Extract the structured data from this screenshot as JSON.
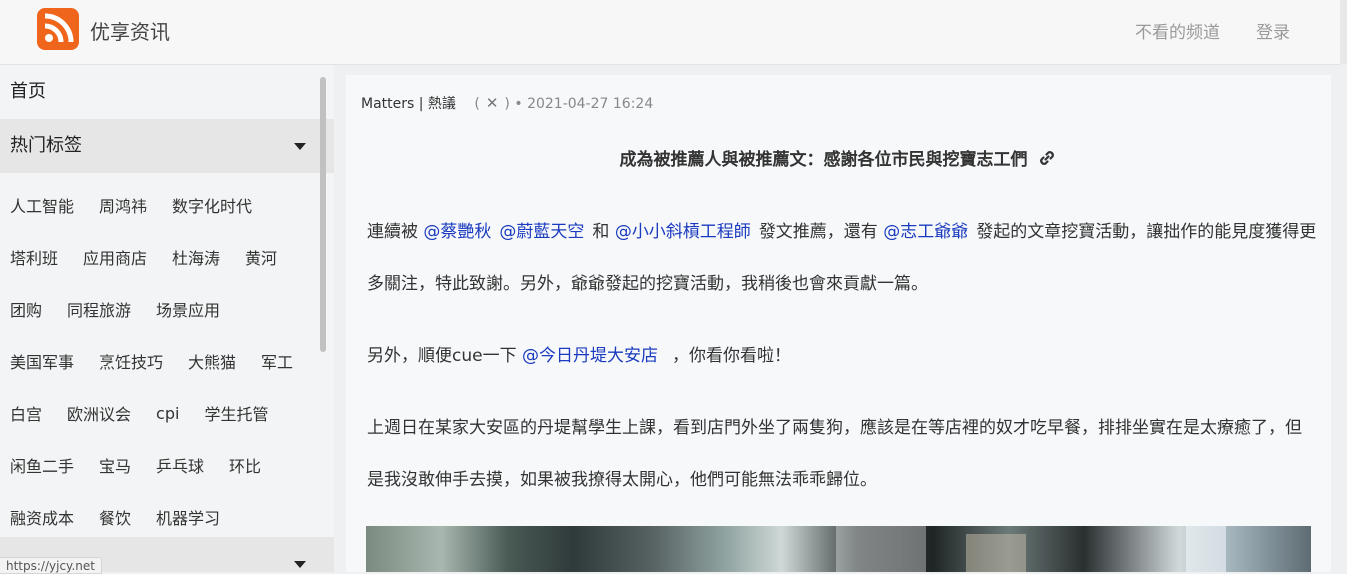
{
  "header": {
    "site_name": "优享资讯",
    "links": {
      "hidden_channels": "不看的频道",
      "login": "登录"
    },
    "brand_color": "#f0651c",
    "logo_icon": "rss-icon"
  },
  "sidebar": {
    "home": "首页",
    "hot_tags_label": "热门标签",
    "tag_rows": [
      [
        "人工智能",
        "周鸿祎",
        "数字化时代"
      ],
      [
        "塔利班",
        "应用商店",
        "杜海涛",
        "黄河"
      ],
      [
        "团购",
        "同程旅游",
        "场景应用"
      ],
      [
        "美国军事",
        "烹饪技巧",
        "大熊猫",
        "军工"
      ],
      [
        "白宫",
        "欧洲议会",
        "cpi",
        "学生托管"
      ],
      [
        "闲鱼二手",
        "宝马",
        "乒乓球",
        "环比"
      ],
      [
        "融资成本",
        "餐饮",
        "机器学习"
      ]
    ]
  },
  "status_bar": {
    "url": "https://yjcy.net"
  },
  "article": {
    "source": "Matters | 熱議",
    "paren_open": "(",
    "paren_close": ")",
    "bullet": "•",
    "date": "2021-04-27 16:24",
    "title": "成為被推薦人與被推薦文：感謝各位市民與挖寶志工們",
    "p1": {
      "t1": "連續被 ",
      "m1": "@蔡艷秋",
      "m2": "@蔚藍天空",
      "t2": "和 ",
      "m3": "@小小斜槓工程師",
      "t3": "發文推薦，還有 ",
      "m4": "@志工爺爺",
      "t4": "發起的文章挖寶活動，讓拙作的能見度獲得更多關注，特此致謝。另外，爺爺發起的挖寶活動，我稍後也會來貢獻一篇。"
    },
    "p2": {
      "t1": "另外，順便cue一下 ",
      "m1": "@今日丹堤大安店",
      "t2": "，你看你看啦！"
    },
    "p3": "上週日在某家大安區的丹堤幫學生上課，看到店門外坐了兩隻狗，應該是在等店裡的奴才吃早餐，排排坐實在是太療癒了，但是我沒敢伸手去摸，如果被我撩得太開心，他們可能無法乖乖歸位。",
    "mention_color": "#1a3bbf"
  }
}
